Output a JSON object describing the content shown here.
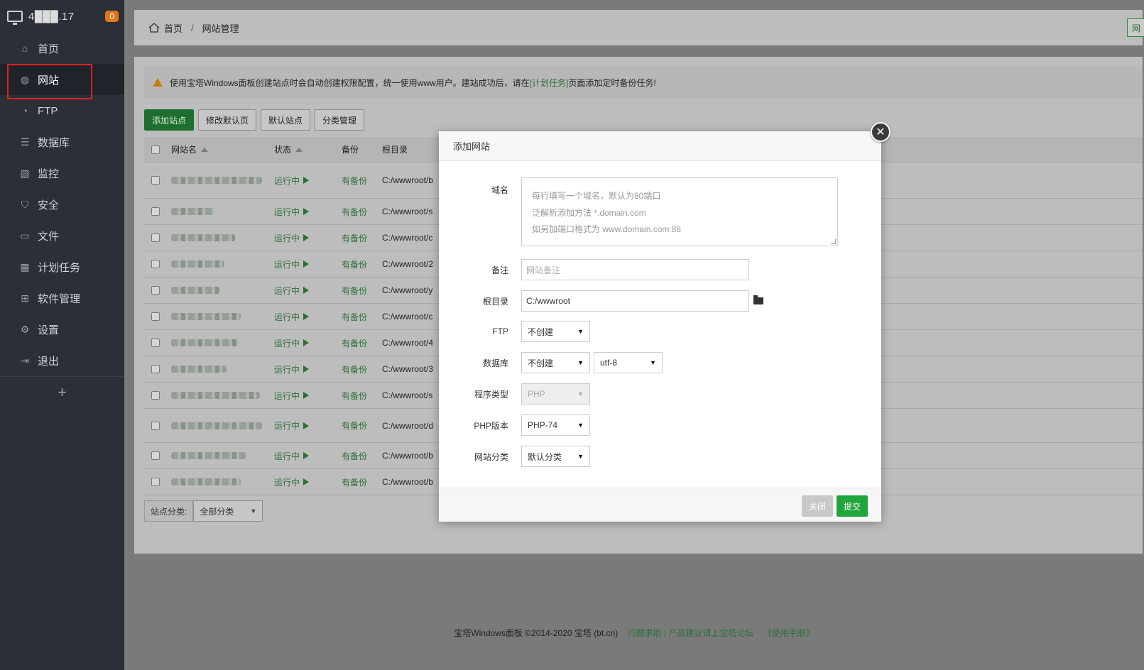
{
  "sidebar": {
    "ip": "4███.17",
    "badge": "0",
    "items": [
      {
        "label": "首页",
        "icon": "home-icon"
      },
      {
        "label": "网站",
        "icon": "globe-icon"
      },
      {
        "label": "FTP",
        "icon": "ftp-icon"
      },
      {
        "label": "数据库",
        "icon": "database-icon"
      },
      {
        "label": "监控",
        "icon": "monitor-icon"
      },
      {
        "label": "安全",
        "icon": "shield-icon"
      },
      {
        "label": "文件",
        "icon": "folder-icon"
      },
      {
        "label": "计划任务",
        "icon": "calendar-icon"
      },
      {
        "label": "软件管理",
        "icon": "grid-icon"
      },
      {
        "label": "设置",
        "icon": "gear-icon"
      },
      {
        "label": "退出",
        "icon": "logout-icon"
      }
    ],
    "add": "+"
  },
  "breadcrumb": {
    "home": "首页",
    "sep": "/",
    "current": "网站管理",
    "right_btn": "网"
  },
  "notice": {
    "text1": "使用宝塔Windows面板创建站点时会自动创建权限配置，统一使用www用户。建站成功后，请在",
    "link": "[计划任务]",
    "text2": "页面添加定时备份任务!"
  },
  "toolbar": {
    "add": "添加站点",
    "modify_default": "修改默认页",
    "default_site": "默认站点",
    "category": "分类管理"
  },
  "table": {
    "headers": {
      "name": "网站名",
      "status": "状态",
      "backup": "备份",
      "root": "根目录"
    },
    "rows": [
      {
        "status": "运行中",
        "backup": "有备份",
        "root": "C:/wwwroot/b"
      },
      {
        "status": "运行中",
        "backup": "有备份",
        "root": "C:/wwwroot/s"
      },
      {
        "status": "运行中",
        "backup": "有备份",
        "root": "C:/wwwroot/c"
      },
      {
        "status": "运行中",
        "backup": "有备份",
        "root": "C:/wwwroot/2"
      },
      {
        "status": "运行中",
        "backup": "有备份",
        "root": "C:/wwwroot/y"
      },
      {
        "status": "运行中",
        "backup": "有备份",
        "root": "C:/wwwroot/c"
      },
      {
        "status": "运行中",
        "backup": "有备份",
        "root": "C:/wwwroot/4"
      },
      {
        "status": "运行中",
        "backup": "有备份",
        "root": "C:/wwwroot/3"
      },
      {
        "status": "运行中",
        "backup": "有备份",
        "root": "C:/wwwroot/s"
      },
      {
        "status": "运行中",
        "backup": "有备份",
        "root": "C:/wwwroot/d"
      },
      {
        "status": "运行中",
        "backup": "有备份",
        "root": "C:/wwwroot/b"
      },
      {
        "status": "运行中",
        "backup": "有备份",
        "root": "C:/wwwroot/b"
      }
    ]
  },
  "category_filter": {
    "label": "站点分类:",
    "value": "全部分类"
  },
  "footer": {
    "copyright": "宝塔Windows面板 ©2014-2020 宝塔 (bt.cn)",
    "help": "问题求助 | 产品建议请上宝塔论坛",
    "manual": "《使用手册》"
  },
  "modal": {
    "title": "添加网站",
    "domain_label": "域名",
    "domain_placeholder": [
      "每行填写一个域名，默认为80端口",
      "泛解析添加方法 *.domain.com",
      "如另加端口格式为 www.domain.com:88"
    ],
    "note_label": "备注",
    "note_placeholder": "网站备注",
    "root_label": "根目录",
    "root_value": "C:/wwwroot",
    "ftp_label": "FTP",
    "ftp_value": "不创建",
    "db_label": "数据库",
    "db_value": "不创建",
    "db_charset": "utf-8",
    "type_label": "程序类型",
    "type_value": "PHP",
    "php_label": "PHP版本",
    "php_value": "PHP-74",
    "cat_label": "网站分类",
    "cat_value": "默认分类",
    "close_btn": "关闭",
    "submit_btn": "提交",
    "close_x": "✕"
  }
}
